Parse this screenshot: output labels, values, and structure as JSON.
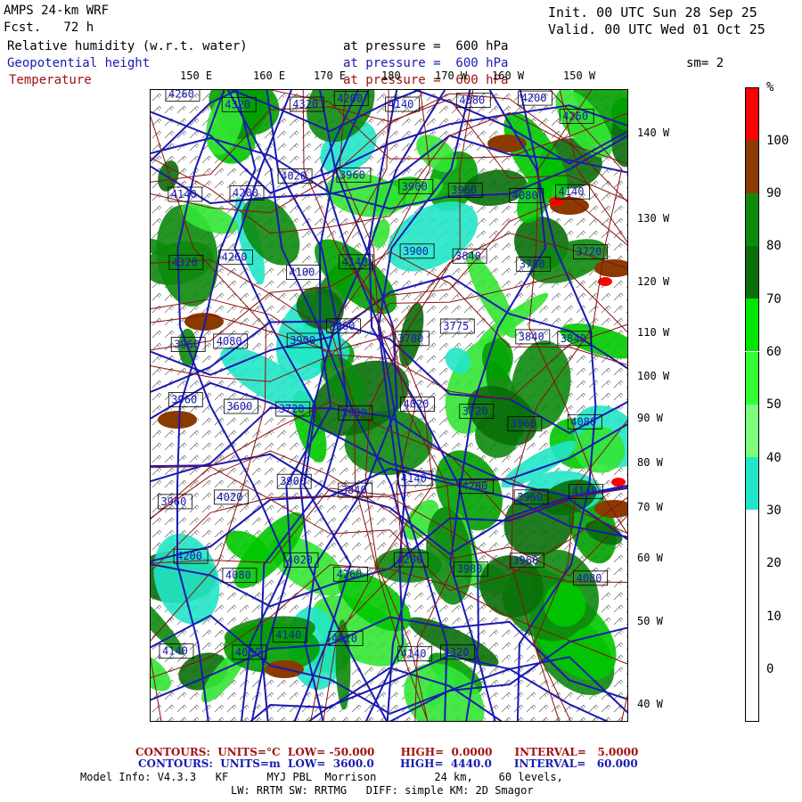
{
  "header": {
    "model": "AMPS 24-km WRF",
    "fcst": "Fcst.   72 h",
    "init": "Init. 00 UTC Sun 28 Sep 25",
    "valid": "Valid. 00 UTC Wed 01 Oct 25"
  },
  "fields": [
    {
      "name": "Relative humidity (w.r.t. water)",
      "level": "at pressure =  600 hPa",
      "color": "#000000"
    },
    {
      "name": "Geopotential height",
      "level": "at pressure =  600 hPa",
      "color": "#1a1ab0"
    },
    {
      "name": "Temperature",
      "level": "at pressure =  600 hPa",
      "color": "#a01010"
    }
  ],
  "smoothing": "sm= 2",
  "lon_labels_top": [
    "150 E",
    "160 E",
    "170 E",
    "180",
    "170 W",
    "160 W",
    "150 W"
  ],
  "lat_labels_right": [
    "140 W",
    "130 W",
    "120 W",
    "110 W",
    "100 W",
    "90 W",
    "80 W",
    "70 W",
    "60 W",
    "50 W",
    "40 W"
  ],
  "colorbar": {
    "unit": "%",
    "labels": [
      "100",
      "90",
      "80",
      "70",
      "60",
      "50",
      "40",
      "30",
      "20",
      "10",
      "0"
    ],
    "colors": [
      "#ff0000",
      "#8b3a00",
      "#0d8a0d",
      "#0a6e0a",
      "#00e600",
      "#33ff33",
      "#7dff7d",
      "#22e6c8",
      "#ffffff",
      "#ffffff",
      "#ffffff",
      "#ffffff"
    ]
  },
  "height_contour_labels": [
    "4260",
    "4320",
    "4320",
    "4200",
    "4140",
    "4380",
    "4200",
    "4260",
    "4140",
    "4200",
    "4020",
    "3960",
    "3900",
    "3960",
    "4080",
    "4140",
    "4320",
    "4260",
    "4100",
    "4140",
    "3900",
    "3840",
    "3780",
    "3720",
    "3960",
    "4080",
    "3900",
    "3960",
    "3780",
    "3775",
    "3840",
    "3840",
    "3960",
    "3600",
    "3720",
    "3900",
    "4020",
    "3720",
    "3960",
    "4080",
    "3960",
    "4020",
    "3900",
    "3840",
    "4140",
    "4200",
    "3960",
    "4140",
    "4200",
    "4080",
    "4020",
    "4260",
    "4200",
    "3980",
    "3960",
    "4080",
    "4140",
    "4080",
    "4140",
    "4020",
    "4140",
    "4320"
  ],
  "footer": {
    "temp_contours": "CONTOURS:  UNITS=°C  LOW= -50.000       HIGH=  0.0000      INTERVAL=   5.0000",
    "height_contours": "CONTOURS:  UNITS=m  LOW=  3600.0       HIGH=  4440.0      INTERVAL=   60.000",
    "model_info_1": "Model Info: V4.3.3   KF      MYJ PBL  Morrison         24 km,    60 levels,",
    "model_info_2": "LW: RRTM SW: RRTMG   DIFF: simple KM: 2D Smagor"
  }
}
